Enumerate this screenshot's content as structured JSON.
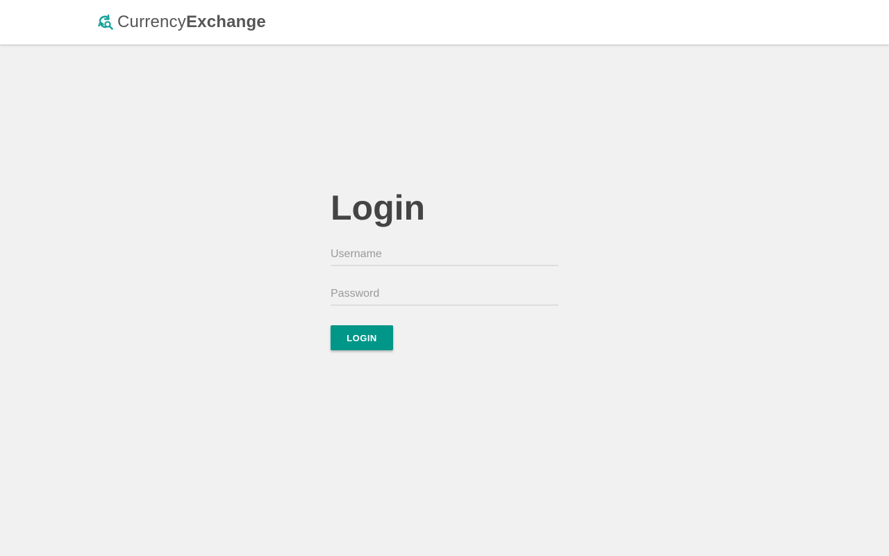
{
  "header": {
    "brand_light": "Currency",
    "brand_bold": "Exchange",
    "logo_icon": "currency-exchange-refresh-search-icon",
    "accent_color": "#009688"
  },
  "login": {
    "title": "Login",
    "username": {
      "placeholder": "Username",
      "value": ""
    },
    "password": {
      "placeholder": "Password",
      "value": ""
    },
    "button_label": "LOGIN"
  }
}
